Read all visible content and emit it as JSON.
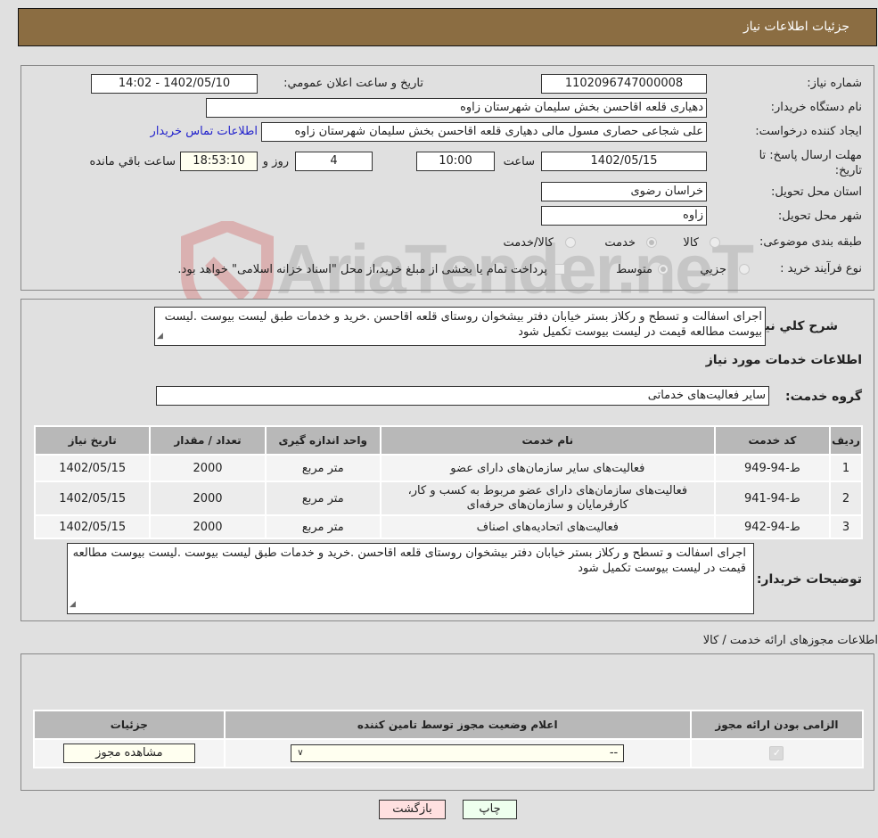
{
  "header": {
    "title": "جزئیات اطلاعات نیاز"
  },
  "details": {
    "need_number_label": "شماره نیاز:",
    "need_number": "1102096747000008",
    "announce_label": "تاریخ و ساعت اعلان عمومي:",
    "announce_value": "1402/05/10 - 14:02",
    "buyer_org_label": "نام دستگاه خریدار:",
    "buyer_org": "دهیاری قلعه اقاحسن بخش سلیمان شهرستان زاوه",
    "creator_label": "ایجاد کننده درخواست:",
    "creator": "علی شجاعی حصاری مسول مالی دهیاری قلعه اقاحسن بخش سلیمان شهرستان زاوه",
    "contact_link": "اطلاعات تماس خریدار",
    "deadline_label_line1": "مهلت ارسال پاسخ: تا",
    "deadline_label_line2": "تاریخ:",
    "deadline_date": "1402/05/15",
    "time_label": "ساعت",
    "deadline_time": "10:00",
    "days_value": "4",
    "days_label": "روز و",
    "remaining_time": "18:53:10",
    "remaining_label": "ساعت باقي مانده",
    "province_label": "استان محل تحویل:",
    "province": "خراسان رضوی",
    "city_label": "شهر محل تحویل:",
    "city": "زاوه",
    "category_label": "طبقه بندی موضوعی:",
    "category_options": [
      {
        "label": "کالا",
        "checked": false
      },
      {
        "label": "خدمت",
        "checked": true
      },
      {
        "label": "کالا/خدمت",
        "checked": false
      }
    ],
    "process_label": "نوع فرآیند خرید :",
    "process_options": [
      {
        "label": "جزيي",
        "checked": false
      },
      {
        "label": "متوسط",
        "checked": true
      }
    ],
    "treasury_note": "پرداخت تمام یا بخشی از مبلغ خرید،از محل \"اسناد خزانه اسلامی\" خواهد بود."
  },
  "watermark": "AriaTender.neT",
  "summary": {
    "label": "شرح کلي نیاز:",
    "text": "اجرای اسفالت و تسطح و رکلاز بستر خیابان دفتر بیشخوان  روستای قلعه اقاحسن .خرید و خدمات طبق لیست بیوست .لیست بیوست مطالعه قیمت در لیست بیوست تکمیل شود"
  },
  "services": {
    "title": "اطلاعات خدمات مورد نیاز",
    "group_label": "گروه خدمت:",
    "group_value": "سایر فعالیت‌های خدماتی",
    "columns": [
      "ردیف",
      "کد خدمت",
      "نام خدمت",
      "واحد اندازه گیری",
      "تعداد / مقدار",
      "تاریخ نیاز"
    ],
    "rows": [
      {
        "index": "1",
        "code": "ط-94-949",
        "name": "فعالیت‌های سایر سازمان‌های دارای عضو",
        "unit": "متر مربع",
        "qty": "2000",
        "date": "1402/05/15"
      },
      {
        "index": "2",
        "code": "ط-94-941",
        "name": "فعالیت‌های سازمان‌های دارای عضو مربوط به کسب و کار، کارفرمایان و سازمان‌های حرفه‌ای",
        "unit": "متر مربع",
        "qty": "2000",
        "date": "1402/05/15"
      },
      {
        "index": "3",
        "code": "ط-94-942",
        "name": "فعالیت‌های اتحادیه‌های اصناف",
        "unit": "متر مربع",
        "qty": "2000",
        "date": "1402/05/15"
      }
    ]
  },
  "buyer_notes": {
    "label": "توضیحات خریدار:",
    "text": "اجرای اسفالت و تسطح و رکلاز بستر خیابان دفتر بیشخوان  روستای قلعه اقاحسن .خرید و خدمات طبق لیست بیوست .لیست بیوست مطالعه قیمت در لیست بیوست تکمیل شود"
  },
  "permits": {
    "title": "اطلاعات مجوزهای ارائه خدمت / کالا",
    "columns": [
      "الزامی بودن ارائه مجوز",
      "اعلام وضعیت مجوز توسط تامین کننده",
      "جزئیات"
    ],
    "required_checked": true,
    "status_selected": "--",
    "view_button": "مشاهده مجوز"
  },
  "footer": {
    "print_button": "چاپ",
    "back_button": "بازگشت"
  }
}
